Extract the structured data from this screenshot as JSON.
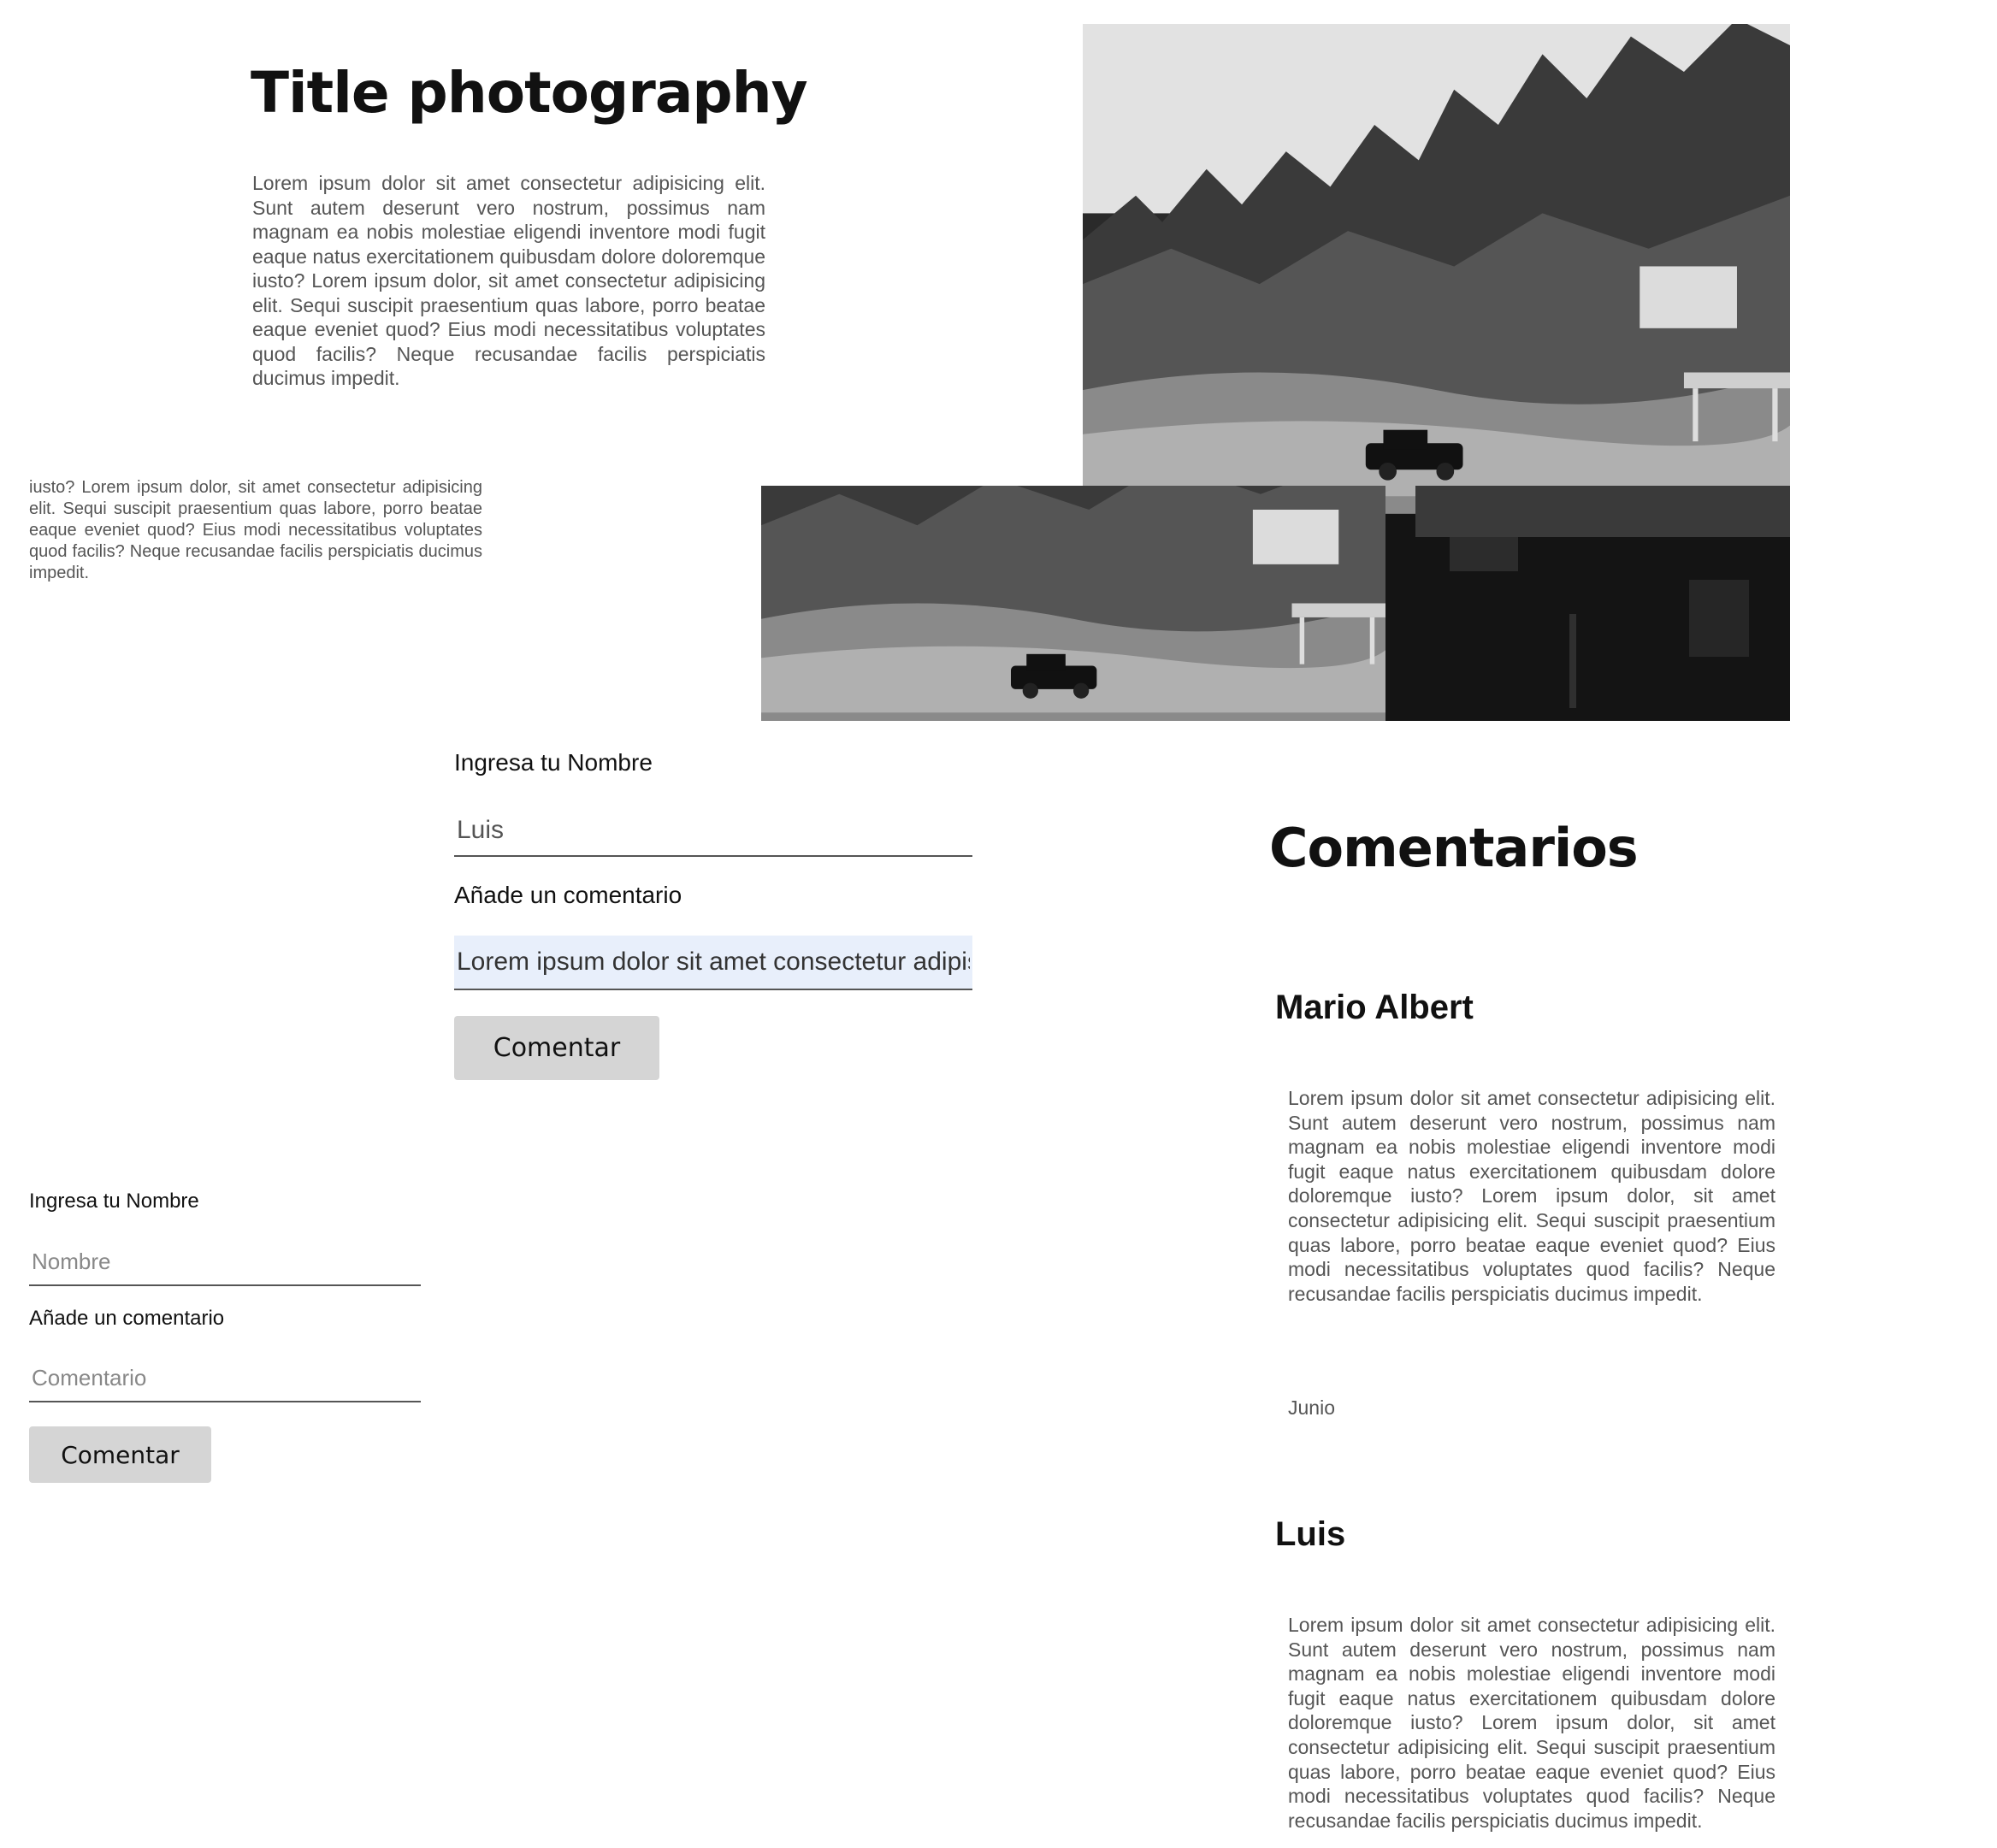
{
  "hero": {
    "title": "Title photography",
    "text": "Lorem ipsum dolor sit amet consectetur adipisicing elit. Sunt autem deserunt vero nostrum, possimus nam magnam ea nobis molestiae eligendi inventore modi fugit eaque natus exercitationem quibusdam dolore doloremque iusto? Lorem ipsum dolor, sit amet consectetur adipisicing elit. Sequi suscipit praesentium quas labore, porro beatae eaque eveniet quod? Eius modi necessitatibus voluptates quod facilis? Neque recusandae facilis perspiciatis ducimus impedit."
  },
  "overlap_text": "eaque natus exercitationem quibusdam dolore doloremque iusto? Lorem ipsum dolor, sit amet consectetur adipisicing elit. Sequi suscipit praesentium quas labore, porro beatae eaque eveniet quod? Eius modi necessitatibus voluptates quod facilis? Neque recusandae facilis perspiciatis ducimus impedit.",
  "form_large": {
    "name_label": "Ingresa tu Nombre",
    "name_value": "Luis",
    "comment_label": "Añade un comentario",
    "comment_value": "Lorem ipsum dolor sit amet consectetur adipisicing elit",
    "button": "Comentar"
  },
  "form_small": {
    "name_label": "Ingresa tu Nombre",
    "name_placeholder": "Nombre",
    "comment_label": "Añade un comentario",
    "comment_placeholder": "Comentario",
    "button": "Comentar"
  },
  "comments": {
    "title": "Comentarios",
    "items": [
      {
        "author": "Mario Albert",
        "text": "Lorem ipsum dolor sit amet consectetur adipisicing elit. Sunt autem deserunt vero nostrum, possimus nam magnam ea nobis molestiae eligendi inventore modi fugit eaque natus exercitationem quibusdam dolore doloremque iusto? Lorem ipsum dolor, sit amet consectetur adipisicing elit. Sequi suscipit praesentium quas labore, porro beatae eaque eveniet quod? Eius modi necessitatibus voluptates quod facilis? Neque recusandae facilis perspiciatis ducimus impedit.",
        "date": "Junio"
      },
      {
        "author": "Luis",
        "text": "Lorem ipsum dolor sit amet consectetur adipisicing elit. Sunt autem deserunt vero nostrum, possimus nam magnam ea nobis molestiae eligendi inventore modi fugit eaque natus exercitationem quibusdam dolore doloremque iusto? Lorem ipsum dolor, sit amet consectetur adipisicing elit. Sequi suscipit praesentium quas labore, porro beatae eaque eveniet quod? Eius modi necessitatibus voluptates quod facilis? Neque recusandae facilis perspiciatis ducimus impedit."
      }
    ]
  }
}
